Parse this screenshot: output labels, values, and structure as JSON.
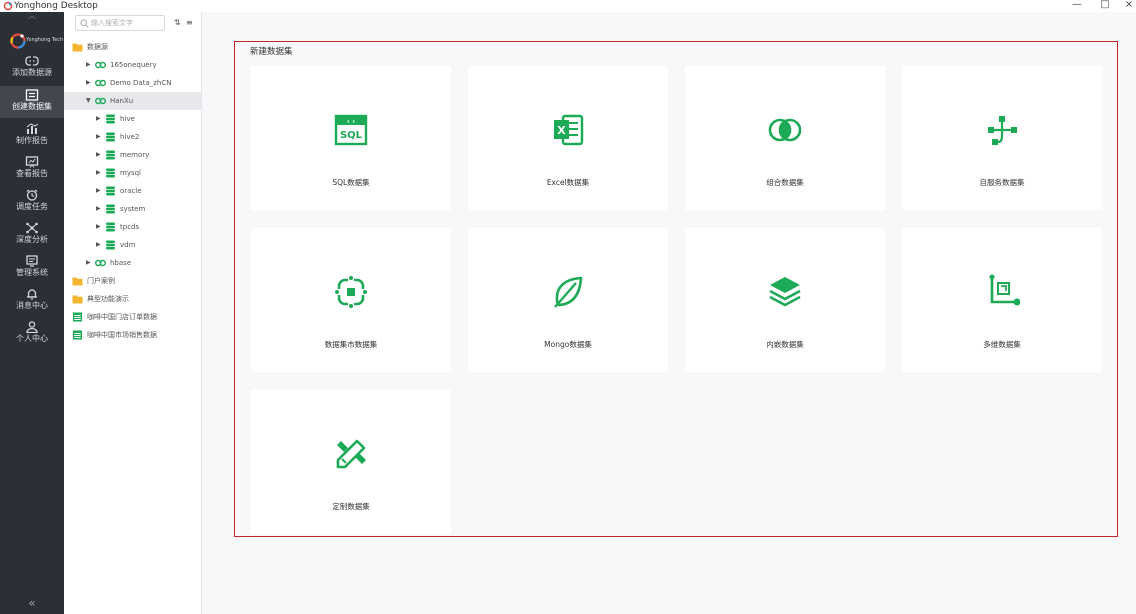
{
  "window": {
    "title": "Yonghong Desktop",
    "controls": [
      "—",
      "□",
      "×"
    ]
  },
  "brand": {
    "name": "Yonghong Tech"
  },
  "nav": {
    "items": [
      {
        "label": "添加数据源",
        "icon": "link-icon"
      },
      {
        "label": "创建数据集",
        "icon": "dataset-icon",
        "active": true
      },
      {
        "label": "制作报告",
        "icon": "chart-icon"
      },
      {
        "label": "查看报告",
        "icon": "presentation-icon"
      },
      {
        "label": "调度任务",
        "icon": "alarm-clock-icon"
      },
      {
        "label": "深度分析",
        "icon": "network-icon"
      },
      {
        "label": "管理系统",
        "icon": "monitor-icon"
      },
      {
        "label": "消息中心",
        "icon": "bell-icon"
      },
      {
        "label": "个人中心",
        "icon": "user-icon"
      }
    ],
    "collapse": "«"
  },
  "tree": {
    "search_placeholder": "输入搜索文字",
    "items": [
      {
        "label": "数据源",
        "type": "folder",
        "level": 0
      },
      {
        "label": "165onequery",
        "type": "connection",
        "level": 1
      },
      {
        "label": "Demo Data_zhCN",
        "type": "connection",
        "level": 1
      },
      {
        "label": "HanXu",
        "type": "connection",
        "level": 1,
        "expanded": true,
        "selected": true
      },
      {
        "label": "hive",
        "type": "database",
        "level": 2
      },
      {
        "label": "hive2",
        "type": "database",
        "level": 2
      },
      {
        "label": "memory",
        "type": "database",
        "level": 2
      },
      {
        "label": "mysql",
        "type": "database",
        "level": 2
      },
      {
        "label": "oracle",
        "type": "database",
        "level": 2
      },
      {
        "label": "system",
        "type": "database",
        "level": 2
      },
      {
        "label": "tpcds",
        "type": "database",
        "level": 2
      },
      {
        "label": "vdm",
        "type": "database",
        "level": 2
      },
      {
        "label": "hbase",
        "type": "connection",
        "level": 1
      },
      {
        "label": "门户案例",
        "type": "folder",
        "level": 0
      },
      {
        "label": "典型功能演示",
        "type": "folder",
        "level": 0
      },
      {
        "label": "咖啡中国门店订单数据",
        "type": "file",
        "level": 0
      },
      {
        "label": "咖啡中国市场销售数据",
        "type": "file",
        "level": 0
      }
    ]
  },
  "main": {
    "heading": "新建数据集",
    "cards": [
      {
        "label": "SQL数据集",
        "icon": "sql-icon"
      },
      {
        "label": "Excel数据集",
        "icon": "excel-icon"
      },
      {
        "label": "组合数据集",
        "icon": "combine-icon"
      },
      {
        "label": "自服务数据集",
        "icon": "flow-icon"
      },
      {
        "label": "数据集市数据集",
        "icon": "datamart-icon"
      },
      {
        "label": "Mongo数据集",
        "icon": "leaf-icon"
      },
      {
        "label": "内嵌数据集",
        "icon": "layers-icon"
      },
      {
        "label": "多维数据集",
        "icon": "dimension-icon"
      },
      {
        "label": "定制数据集",
        "icon": "pencil-ruler-icon"
      }
    ]
  },
  "colors": {
    "accent": "#1daa57",
    "frame": "#c0262c",
    "nav_bg": "#2b2f36"
  }
}
